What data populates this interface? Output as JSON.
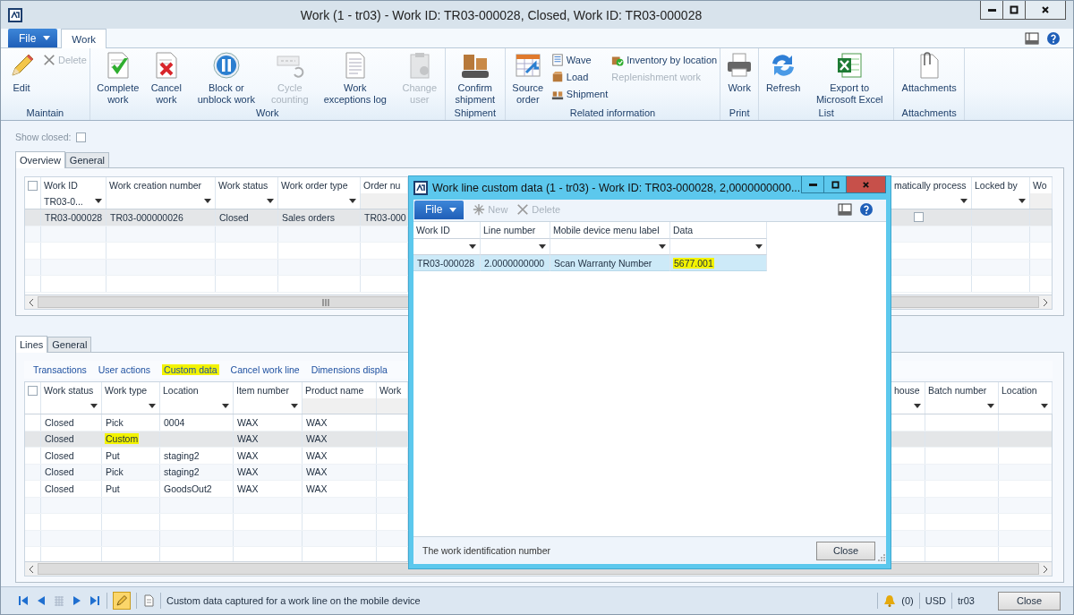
{
  "window": {
    "title": "Work (1 - tr03) - Work ID: TR03-000028, Closed, Work ID: TR03-000028"
  },
  "ribbon": {
    "file_button": "File",
    "tabs": [
      {
        "label": "Work",
        "selected": true
      }
    ],
    "groups": [
      {
        "label": "Maintain",
        "items": [
          {
            "kind": "large",
            "label": "Edit",
            "disabled": false
          },
          {
            "kind": "stack",
            "items": [
              {
                "label": "Delete",
                "disabled": true
              }
            ]
          }
        ]
      },
      {
        "label": "Work",
        "items": [
          {
            "kind": "large",
            "label": "Complete work",
            "disabled": false
          },
          {
            "kind": "large",
            "label": "Cancel work",
            "disabled": false
          },
          {
            "kind": "large",
            "label": "Block or unblock work",
            "disabled": false
          },
          {
            "kind": "large",
            "label": "Cycle counting",
            "disabled": true
          },
          {
            "kind": "large",
            "label": "Work exceptions log",
            "disabled": false
          },
          {
            "kind": "large",
            "label": "Change user",
            "disabled": true
          }
        ]
      },
      {
        "label": "Shipment",
        "items": [
          {
            "kind": "large",
            "label": "Confirm shipment",
            "disabled": false
          }
        ]
      },
      {
        "label": "Related information",
        "items": [
          {
            "kind": "large",
            "label": "Source order",
            "disabled": false
          },
          {
            "kind": "stack",
            "items": [
              {
                "label": "Wave",
                "disabled": false
              },
              {
                "label": "Load",
                "disabled": false
              },
              {
                "label": "Shipment",
                "disabled": false
              }
            ]
          },
          {
            "kind": "stack",
            "items": [
              {
                "label": "Inventory by location",
                "disabled": false
              },
              {
                "label": "Replenishment work",
                "disabled": true
              }
            ]
          }
        ]
      },
      {
        "label": "Print",
        "items": [
          {
            "kind": "large",
            "label": "Work",
            "disabled": false
          }
        ]
      },
      {
        "label": "List",
        "items": [
          {
            "kind": "large",
            "label": "Refresh",
            "disabled": false
          },
          {
            "kind": "large",
            "label": "Export to Microsoft Excel",
            "disabled": false
          }
        ]
      },
      {
        "label": "Attachments",
        "items": [
          {
            "kind": "large",
            "label": "Attachments",
            "disabled": false
          }
        ]
      }
    ]
  },
  "show_closed": {
    "label": "Show closed:",
    "checked": false
  },
  "work_overview": {
    "tabs": [
      {
        "label": "Overview",
        "selected": true
      },
      {
        "label": "General",
        "selected": false
      }
    ],
    "grid": {
      "select_all_checked": false,
      "columns": [
        {
          "label": "Work ID",
          "filterable": true,
          "filter": "TR03-0..."
        },
        {
          "label": "Work creation number",
          "filterable": true
        },
        {
          "label": "Work status",
          "filterable": true
        },
        {
          "label": "Work order type",
          "filterable": true
        },
        {
          "label": "Order nu",
          "filterable": false
        }
      ],
      "columns_right": [
        {
          "label": "matically process",
          "filterable": true
        },
        {
          "label": "Locked by",
          "filterable": true
        },
        {
          "label": "Wo",
          "filterable": false
        }
      ],
      "rows": [
        {
          "selected": true,
          "cells": [
            {
              "text": "TR03-000028"
            },
            {
              "text": "TR03-000000026"
            },
            {
              "text": "Closed"
            },
            {
              "text": "Sales orders"
            },
            {
              "text": "TR03-000"
            }
          ],
          "right_cells": [
            {
              "kind": "check",
              "checked": false
            }
          ]
        }
      ]
    }
  },
  "work_lines": {
    "tabs": [
      {
        "label": "Lines",
        "selected": true
      },
      {
        "label": "General",
        "selected": false
      }
    ],
    "actions": [
      {
        "label": "Transactions",
        "highlighted": false
      },
      {
        "label": "User actions",
        "highlighted": false
      },
      {
        "label": "Custom data",
        "highlighted": true
      },
      {
        "label": "Cancel work line",
        "highlighted": false
      },
      {
        "label": "Dimensions displa",
        "highlighted": false
      }
    ],
    "grid": {
      "select_all_checked": false,
      "columns": [
        {
          "label": "Work status",
          "filterable": true
        },
        {
          "label": "Work type",
          "filterable": true
        },
        {
          "label": "Location",
          "filterable": true
        },
        {
          "label": "Item number",
          "filterable": true
        },
        {
          "label": "Product name",
          "filterable": false
        },
        {
          "label": "Work",
          "filterable": false
        }
      ],
      "columns_right": [
        {
          "label": "house",
          "filterable": true
        },
        {
          "label": "Batch number",
          "filterable": true
        },
        {
          "label": "Location",
          "filterable": true
        }
      ],
      "rows": [
        {
          "selected": false,
          "cells": [
            {
              "text": "Closed"
            },
            {
              "text": "Pick"
            },
            {
              "text": "0004"
            },
            {
              "text": "WAX"
            },
            {
              "text": "WAX"
            }
          ]
        },
        {
          "selected": true,
          "cells": [
            {
              "text": "Closed"
            },
            {
              "text": "Custom",
              "highlighted": true
            },
            {},
            {
              "text": "WAX"
            },
            {
              "text": "WAX"
            }
          ]
        },
        {
          "selected": false,
          "cells": [
            {
              "text": "Closed"
            },
            {
              "text": "Put"
            },
            {
              "text": "staging2"
            },
            {
              "text": "WAX"
            },
            {
              "text": "WAX"
            }
          ]
        },
        {
          "selected": false,
          "cells": [
            {
              "text": "Closed"
            },
            {
              "text": "Pick"
            },
            {
              "text": "staging2"
            },
            {
              "text": "WAX"
            },
            {
              "text": "WAX"
            }
          ]
        },
        {
          "selected": false,
          "cells": [
            {
              "text": "Closed"
            },
            {
              "text": "Put"
            },
            {
              "text": "GoodsOut2"
            },
            {
              "text": "WAX"
            },
            {
              "text": "WAX"
            }
          ]
        }
      ]
    }
  },
  "dialog": {
    "title": "Work line custom data (1 - tr03) - Work ID: TR03-000028, 2,0000000000...",
    "file_button": "File",
    "toolbar": [
      {
        "label": "New",
        "disabled": true
      },
      {
        "label": "Delete",
        "disabled": true
      }
    ],
    "grid": {
      "columns": [
        {
          "label": "Work ID",
          "filterable": true
        },
        {
          "label": "Line number",
          "filterable": true
        },
        {
          "label": "Mobile device menu label",
          "filterable": true
        },
        {
          "label": "Data",
          "filterable": true
        }
      ],
      "rows": [
        {
          "selected": true,
          "cells": [
            {
              "text": "TR03-000028"
            },
            {
              "text": "2.0000000000"
            },
            {
              "text": "Scan Warranty Number"
            },
            {
              "text": "5677.001",
              "highlighted": true
            }
          ]
        }
      ]
    },
    "help_text": "The work identification number",
    "close_button": "Close"
  },
  "status_bar": {
    "edit_mode": true,
    "message": "Custom data captured for a work line on the mobile device",
    "notifications": "(0)",
    "currency": "USD",
    "company": "tr03",
    "close_button": "Close"
  }
}
